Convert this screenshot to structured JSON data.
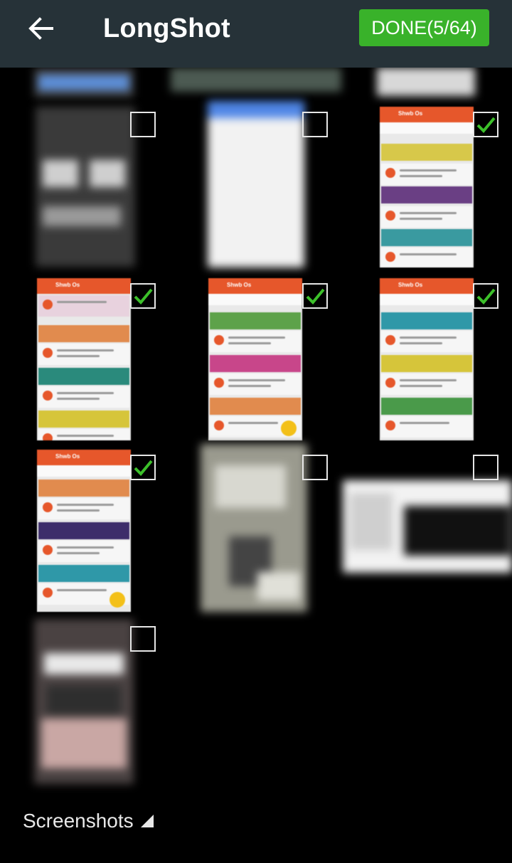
{
  "appbar": {
    "title": "LongShot",
    "done_label": "DONE(5/64)"
  },
  "footer": {
    "album_label": "Screenshots"
  },
  "thumbnails": [
    {
      "id": "r0c0",
      "selected": false
    },
    {
      "id": "r0c1",
      "selected": false
    },
    {
      "id": "r0c2",
      "selected": false
    },
    {
      "id": "r1c0",
      "selected": false
    },
    {
      "id": "r1c1",
      "selected": false
    },
    {
      "id": "r1c2",
      "selected": true
    },
    {
      "id": "r2c0",
      "selected": true
    },
    {
      "id": "r2c1",
      "selected": true
    },
    {
      "id": "r2c2",
      "selected": true
    },
    {
      "id": "r3c0",
      "selected": true
    },
    {
      "id": "r3c1",
      "selected": false
    },
    {
      "id": "r3c2",
      "selected": false
    },
    {
      "id": "r4c0",
      "selected": false
    }
  ],
  "icons": {
    "back": "arrow-left-icon",
    "check": "checkmark-icon",
    "dropdown": "triangle-dropdown-icon"
  },
  "colors": {
    "appbar": "#263238",
    "done": "#39b22a",
    "check": "#3cc02a",
    "accent": "#e6572b"
  }
}
